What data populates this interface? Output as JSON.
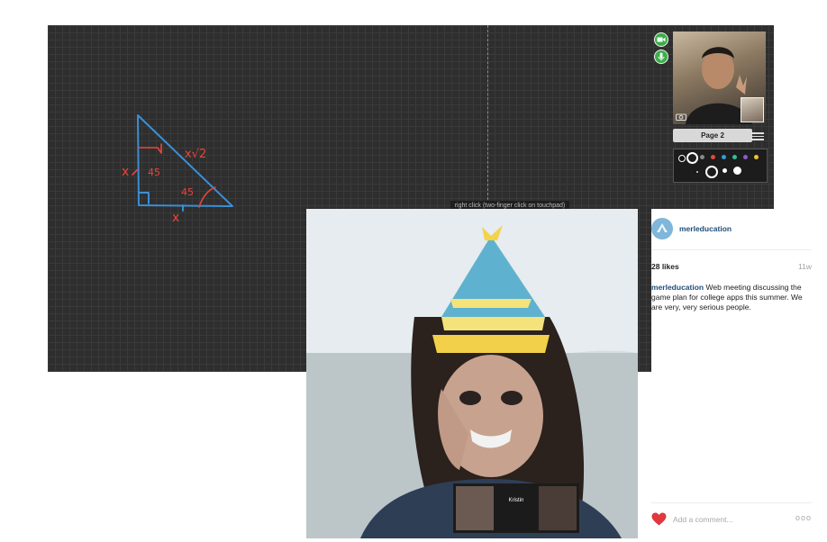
{
  "whiteboard": {
    "hint_text": "right click (two-finger click on touchpad)",
    "page_label": "Page 2",
    "palette_colors": [
      "#111111",
      "#ffffff",
      "#888888",
      "#e04a3b",
      "#2e9fd8",
      "#2fbfa2",
      "#8a5cc9",
      "#f2c230"
    ],
    "stroke_color": "#3a8fd6",
    "annotation_color": "#e8463a",
    "camera_button_color": "#3cae4a",
    "icons": [
      "video-camera-icon",
      "microphone-icon",
      "camera-snapshot-icon",
      "menu-icon"
    ],
    "drawing": {
      "hypotenuse_label": "x√2",
      "side_label": "x",
      "base_label": "x",
      "angle_top": "45",
      "angle_bottom": "45"
    }
  },
  "instagram": {
    "username": "merleducation",
    "likes": "28 likes",
    "age": "11w",
    "caption_user": "merleducation",
    "caption_text": " Web meeting discussing the game plan for college apps this summer. We are very, very serious people.",
    "comment_placeholder": "Add a comment...",
    "more_label": "ooo",
    "photo_tile_label": "Kristin",
    "heart_color": "#e0383e",
    "icons": [
      "heart-icon",
      "more-options-icon"
    ]
  }
}
